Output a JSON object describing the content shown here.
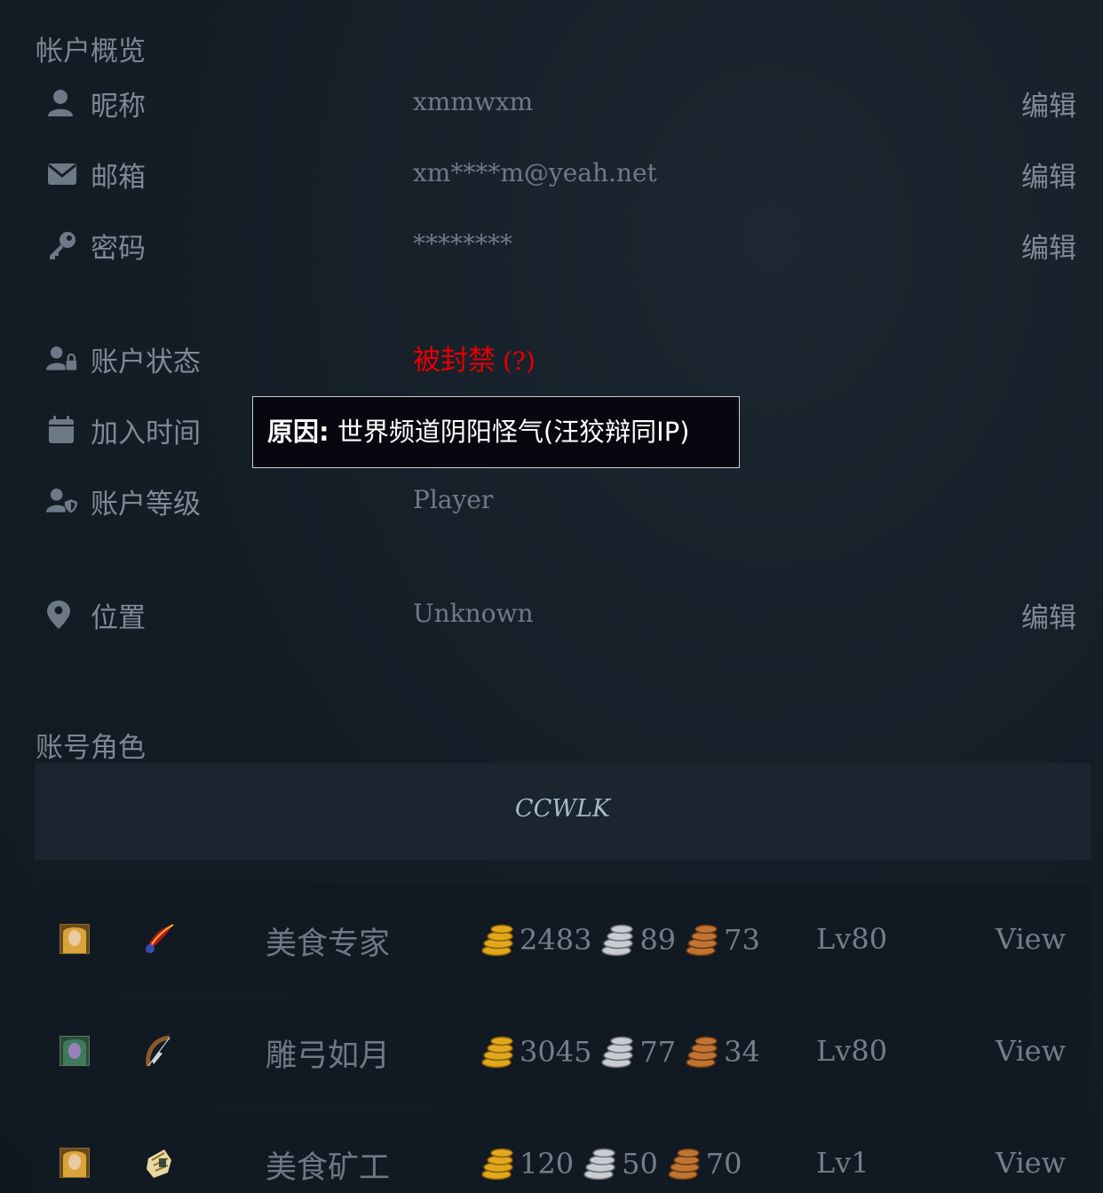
{
  "overview": {
    "title": "帐户概览",
    "edit_label": "编辑",
    "nickname": {
      "label": "昵称",
      "value": "xmmwxm",
      "icon": "user-icon"
    },
    "email": {
      "label": "邮箱",
      "value": "xm****m@yeah.net",
      "icon": "envelope-icon"
    },
    "password": {
      "label": "密码",
      "value": "********",
      "icon": "key-icon"
    },
    "status": {
      "label": "账户状态",
      "value": "被封禁",
      "help": "(?)",
      "icon": "user-lock-icon",
      "color": "#e60000"
    },
    "join_time": {
      "label": "加入时间",
      "icon": "calendar-icon"
    },
    "level": {
      "label": "账户等级",
      "value": "Player",
      "icon": "user-shield-icon"
    },
    "location": {
      "label": "位置",
      "value": "Unknown",
      "icon": "map-marker-icon"
    }
  },
  "tooltip": {
    "prefix": "原因:",
    "text": " 世界频道阴阳怪气(汪狡辩同IP)"
  },
  "characters_section": {
    "title": "账号角色",
    "realm": "CCWLK",
    "view_label": "View",
    "characters": [
      {
        "name": "美食专家",
        "gold": "2483",
        "silver": "89",
        "copper": "73",
        "level": "Lv80",
        "portrait": "blonde-human-female-portrait",
        "class_icon": "feather-class-icon"
      },
      {
        "name": "雕弓如月",
        "gold": "3045",
        "silver": "77",
        "copper": "34",
        "level": "Lv80",
        "portrait": "night-elf-female-portrait",
        "class_icon": "bow-class-icon"
      },
      {
        "name": "美食矿工",
        "gold": "120",
        "silver": "50",
        "copper": "70",
        "level": "Lv1",
        "portrait": "blonde-human-female-portrait",
        "class_icon": "fist-class-icon"
      }
    ]
  },
  "colors": {
    "gold": "#e0a91c",
    "silver": "#c9ccd1",
    "copper": "#c07433"
  }
}
